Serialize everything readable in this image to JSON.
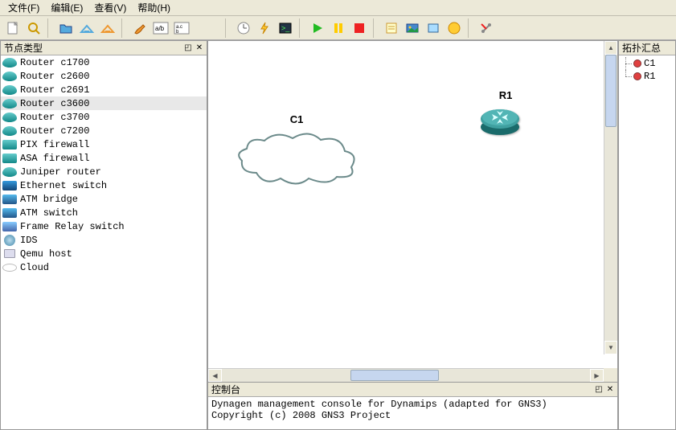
{
  "menu": {
    "file": "文件(F)",
    "edit": "编辑(E)",
    "view": "查看(V)",
    "help": "帮助(H)"
  },
  "panels": {
    "node_types_title": "节点类型",
    "topology_title": "拓扑汇总",
    "console_title": "控制台"
  },
  "node_types": [
    {
      "label": "Router c1700",
      "type": "router"
    },
    {
      "label": "Router c2600",
      "type": "router"
    },
    {
      "label": "Router c2691",
      "type": "router"
    },
    {
      "label": "Router c3600",
      "type": "router",
      "selected": true
    },
    {
      "label": "Router c3700",
      "type": "router"
    },
    {
      "label": "Router c7200",
      "type": "router"
    },
    {
      "label": "PIX firewall",
      "type": "firewall"
    },
    {
      "label": "ASA firewall",
      "type": "firewall"
    },
    {
      "label": "Juniper router",
      "type": "router"
    },
    {
      "label": "Ethernet switch",
      "type": "switch"
    },
    {
      "label": "ATM bridge",
      "type": "atm"
    },
    {
      "label": "ATM switch",
      "type": "atm"
    },
    {
      "label": "Frame Relay switch",
      "type": "fr"
    },
    {
      "label": "IDS",
      "type": "ids"
    },
    {
      "label": "Qemu host",
      "type": "host"
    },
    {
      "label": "Cloud",
      "type": "cloud"
    }
  ],
  "canvas": {
    "cloud_label": "C1",
    "router_label": "R1"
  },
  "topology": [
    {
      "label": "C1"
    },
    {
      "label": "R1"
    }
  ],
  "console": {
    "line1": "Dynagen management console for Dynamips (adapted for GNS3)",
    "line2": "Copyright (c) 2008 GNS3 Project"
  }
}
